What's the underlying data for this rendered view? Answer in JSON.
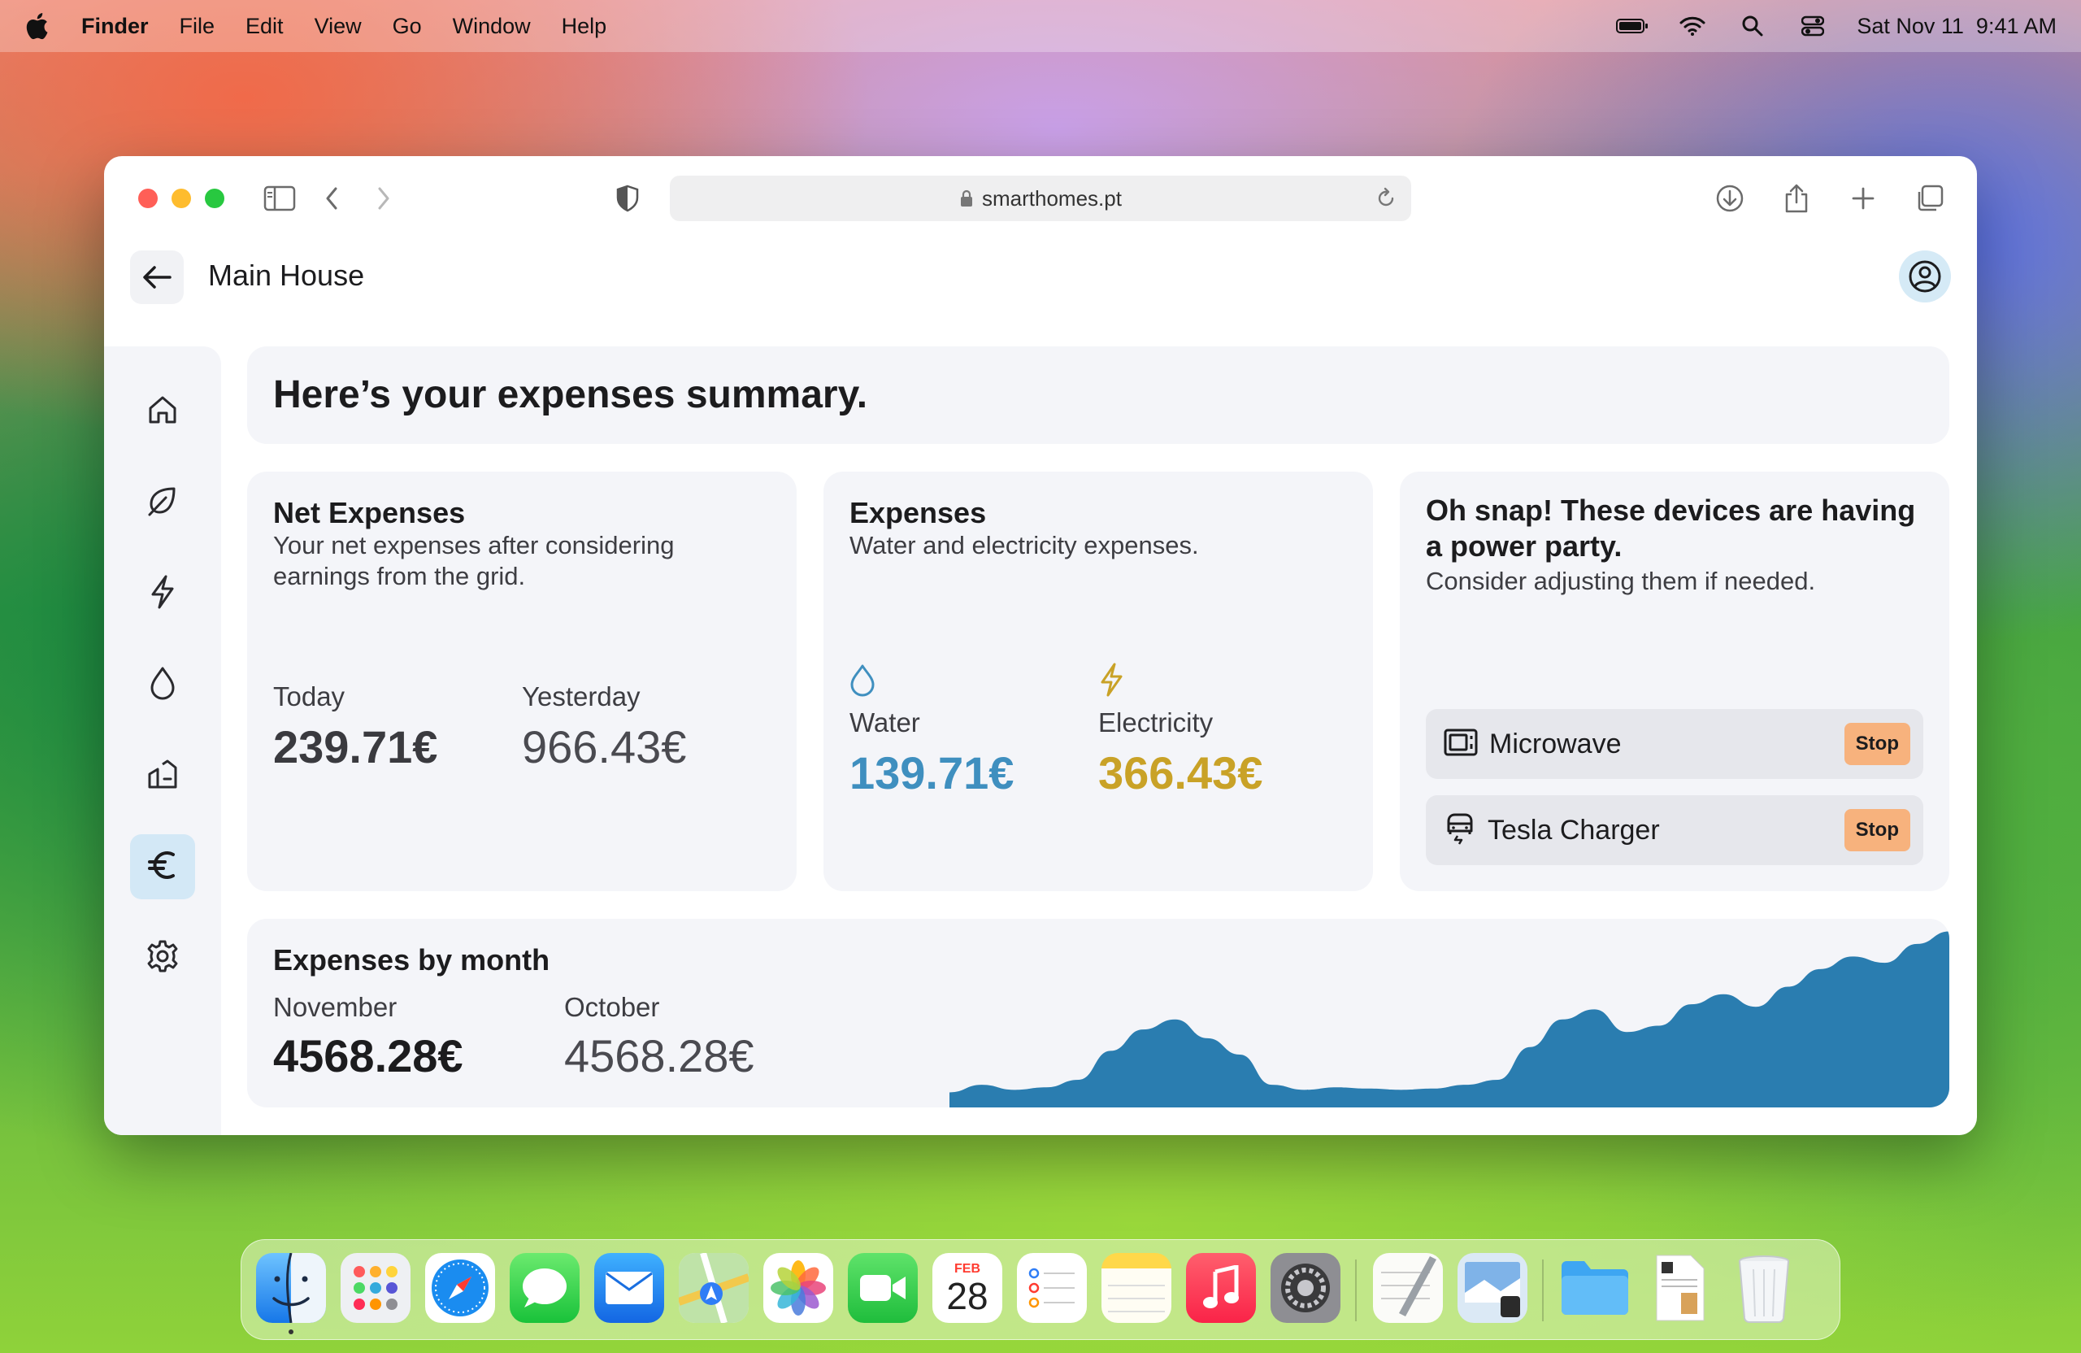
{
  "menubar": {
    "app_name": "Finder",
    "items": [
      "File",
      "Edit",
      "View",
      "Go",
      "Window",
      "Help"
    ],
    "clock": "Sat Nov 11  9:41 AM"
  },
  "browser": {
    "url": "smarthomes.pt"
  },
  "app": {
    "title": "Main House",
    "sidebar": [
      "home-icon",
      "leaf-icon",
      "bolt-icon",
      "water-drop-icon",
      "devices-icon",
      "euro-icon",
      "settings-icon"
    ],
    "active_section": "euro-icon"
  },
  "summary": {
    "heading": "Here’s your expenses summary."
  },
  "net_expenses": {
    "title": "Net Expenses",
    "subtitle_line1": "Your net expenses after considering",
    "subtitle_line2": "earnings from the grid.",
    "today_label": "Today",
    "today_value": "239.71€",
    "yesterday_label": "Yesterday",
    "yesterday_value": "966.43€"
  },
  "expenses": {
    "title": "Expenses",
    "subtitle": "Water and electricity expenses.",
    "water_label": "Water",
    "water_value": "139.71€",
    "electricity_label": "Electricity",
    "electricity_value": "366.43€",
    "water_color": "#3f8fbf",
    "electricity_color": "#c9a227"
  },
  "power_party": {
    "title_line1": "Oh snap! These devices are having",
    "title_line2": "a power party.",
    "subtitle": "Consider adjusting them if needed.",
    "devices": [
      {
        "name": "Microwave",
        "icon": "microwave-icon",
        "action": "Stop"
      },
      {
        "name": "Tesla Charger",
        "icon": "car-icon",
        "action": "Stop"
      }
    ],
    "stop_color": "#f7b27d"
  },
  "monthly": {
    "title": "Expenses by month",
    "current_label": "November",
    "current_value": "4568.28€",
    "previous_label": "October",
    "previous_value": "4568.28€",
    "chart_color": "#2a7db0"
  },
  "chart_data": {
    "type": "area",
    "title": "",
    "xlabel": "",
    "ylabel": "",
    "x": [
      0,
      1,
      2,
      3,
      4,
      5,
      6,
      7,
      8,
      9,
      10,
      11,
      12,
      13,
      14,
      15,
      16,
      17,
      18,
      19,
      20,
      21,
      22,
      23,
      24,
      25,
      26,
      27,
      28,
      29,
      30,
      31
    ],
    "values": [
      12,
      18,
      14,
      16,
      22,
      45,
      62,
      70,
      55,
      42,
      18,
      14,
      16,
      15,
      14,
      15,
      18,
      22,
      48,
      70,
      78,
      60,
      65,
      82,
      90,
      80,
      96,
      110,
      120,
      115,
      130,
      140
    ],
    "ylim": [
      0,
      150
    ],
    "grid": false,
    "legend": "none"
  },
  "calendar_icon": {
    "month": "FEB",
    "day": "28"
  },
  "dock": [
    "finder-icon",
    "launchpad-icon",
    "safari-icon",
    "messages-icon",
    "mail-icon",
    "maps-icon",
    "photos-icon",
    "facetime-icon",
    "calendar-icon",
    "reminders-icon",
    "notes-icon",
    "music-icon",
    "system-settings-icon",
    "textedit-icon",
    "preview-icon",
    "folder-icon",
    "document-icon",
    "trash-icon"
  ]
}
